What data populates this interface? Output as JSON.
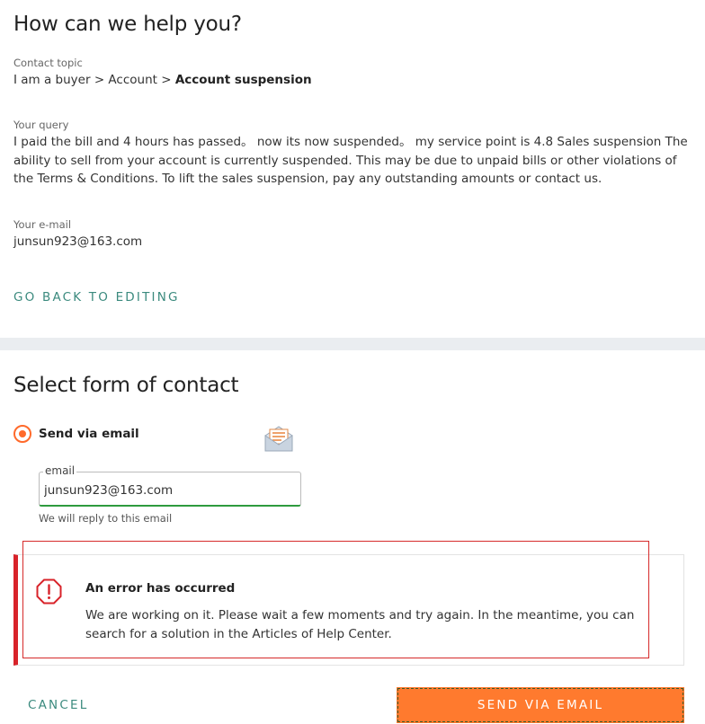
{
  "summary": {
    "title": "How can we help you?",
    "topic_label": "Contact topic",
    "topic_path": "I am a buyer > Account > ",
    "topic_bold": "Account suspension",
    "query_label": "Your query",
    "query_text": "I paid the bill and 4 hours has passed。 now its now suspended。 my service point is 4.8 Sales suspension The ability to sell from your account is currently suspended. This may be due to unpaid bills or other violations of the Terms & Conditions. To lift the sales suspension, pay any outstanding amounts or contact us.",
    "email_label": "Your e-mail",
    "email_value": "junsun923@163.com",
    "back_link": "GO BACK TO EDITING"
  },
  "contact": {
    "title": "Select form of contact",
    "option_label": "Send via email",
    "field_legend": "email",
    "field_value": "junsun923@163.com",
    "field_hint": "We will reply to this email"
  },
  "error": {
    "title": "An error has occurred",
    "message": "We are working on it. Please wait a few moments and try again. In the meantime, you can search for a solution in the Articles of Help Center."
  },
  "actions": {
    "cancel_label": "CANCEL",
    "send_label": "SEND VIA EMAIL"
  },
  "colors": {
    "accent": "#ff7a2e",
    "link": "#3b8a7e",
    "error": "#d8232a",
    "valid": "#2e9b3e"
  }
}
